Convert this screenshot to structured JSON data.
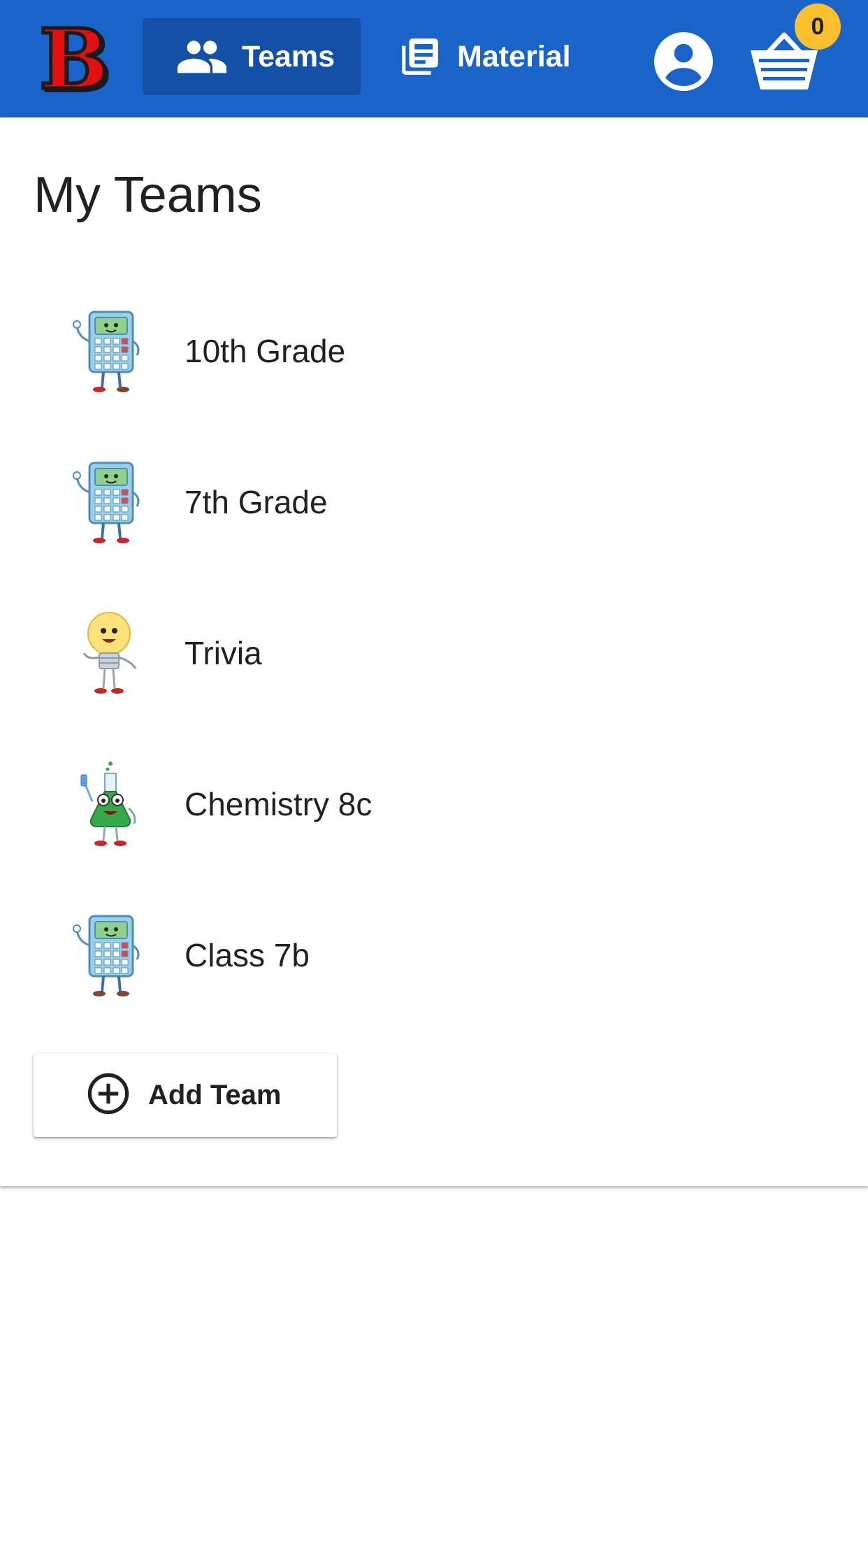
{
  "header": {
    "logo_letter": "B",
    "nav": {
      "teams_label": "Teams",
      "material_label": "Material"
    },
    "cart_count": "0",
    "icons": [
      "group-icon",
      "newspaper-icon",
      "account-circle-icon",
      "basket-icon"
    ]
  },
  "main": {
    "title": "My Teams",
    "teams": [
      {
        "name": "10th Grade",
        "avatar": "calculator-mascot"
      },
      {
        "name": "7th Grade",
        "avatar": "calculator-mascot"
      },
      {
        "name": "Trivia",
        "avatar": "lightbulb-mascot"
      },
      {
        "name": "Chemistry 8c",
        "avatar": "flask-mascot"
      },
      {
        "name": "Class 7b",
        "avatar": "calculator-mascot"
      }
    ],
    "add_team_label": "Add Team"
  },
  "colors": {
    "appbar": "#1a63c9",
    "active_nav": "#1550a8",
    "badge": "#fbc02d",
    "logo": "#e01010"
  }
}
